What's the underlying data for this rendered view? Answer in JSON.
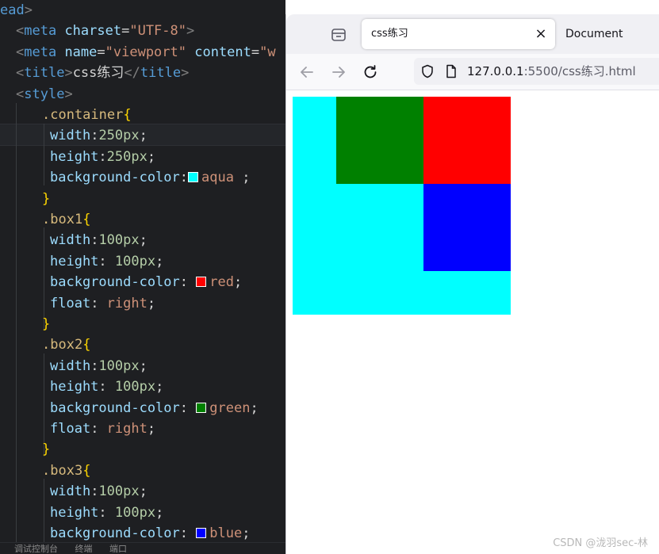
{
  "editor": {
    "bottom_tabs": [
      "调试控制台",
      "终端",
      "端口"
    ],
    "lines": [
      [
        [
          "tag",
          "ead"
        ],
        [
          "punc",
          ">"
        ]
      ],
      [
        [
          "punc",
          "<"
        ],
        [
          "tag",
          "meta "
        ],
        [
          "attr",
          "charset"
        ],
        [
          "txt",
          "="
        ],
        [
          "str",
          "\"UTF-8\""
        ],
        [
          "punc",
          ">"
        ]
      ],
      [
        [
          "punc",
          "<"
        ],
        [
          "tag",
          "meta "
        ],
        [
          "attr",
          "name"
        ],
        [
          "txt",
          "="
        ],
        [
          "str",
          "\"viewport\""
        ],
        [
          "attr",
          " content"
        ],
        [
          "txt",
          "="
        ],
        [
          "str",
          "\"w"
        ]
      ],
      [
        [
          "punc",
          "<"
        ],
        [
          "tag",
          "title"
        ],
        [
          "punc",
          ">"
        ],
        [
          "txt",
          "css练习"
        ],
        [
          "punc",
          "</"
        ],
        [
          "tag",
          "title"
        ],
        [
          "punc",
          ">"
        ]
      ],
      [
        [
          "punc",
          "<"
        ],
        [
          "tag",
          "style"
        ],
        [
          "punc",
          ">"
        ]
      ],
      [
        [
          "sel",
          ".container"
        ],
        [
          "brace",
          "{"
        ]
      ],
      [
        [
          "prop",
          "width"
        ],
        [
          "txt",
          ":"
        ],
        [
          "num",
          "250px"
        ],
        [
          "txt",
          ";"
        ]
      ],
      [
        [
          "prop",
          "height"
        ],
        [
          "txt",
          ":"
        ],
        [
          "num",
          "250px"
        ],
        [
          "txt",
          ";"
        ]
      ],
      [
        [
          "prop",
          "background-color"
        ],
        [
          "txt",
          ":"
        ],
        [
          "swatch",
          "#00ffff"
        ],
        [
          "kw",
          "aqua"
        ],
        [
          "txt",
          " ;"
        ]
      ],
      [
        [
          "brace",
          "}"
        ]
      ],
      [
        [
          "sel",
          ".box1"
        ],
        [
          "brace",
          "{"
        ]
      ],
      [
        [
          "prop",
          "width"
        ],
        [
          "txt",
          ":"
        ],
        [
          "num",
          "100px"
        ],
        [
          "txt",
          ";"
        ]
      ],
      [
        [
          "prop",
          "height"
        ],
        [
          "txt",
          ": "
        ],
        [
          "num",
          "100px"
        ],
        [
          "txt",
          ";"
        ]
      ],
      [
        [
          "prop",
          "background-color"
        ],
        [
          "txt",
          ": "
        ],
        [
          "swatch",
          "#ff0000"
        ],
        [
          "kw",
          "red"
        ],
        [
          "txt",
          ";"
        ]
      ],
      [
        [
          "prop",
          "float"
        ],
        [
          "txt",
          ": "
        ],
        [
          "kw",
          "right"
        ],
        [
          "txt",
          ";"
        ]
      ],
      [
        [
          "brace",
          "}"
        ]
      ],
      [
        [
          "sel",
          ".box2"
        ],
        [
          "brace",
          "{"
        ]
      ],
      [
        [
          "prop",
          "width"
        ],
        [
          "txt",
          ":"
        ],
        [
          "num",
          "100px"
        ],
        [
          "txt",
          ";"
        ]
      ],
      [
        [
          "prop",
          "height"
        ],
        [
          "txt",
          ": "
        ],
        [
          "num",
          "100px"
        ],
        [
          "txt",
          ";"
        ]
      ],
      [
        [
          "prop",
          "background-color"
        ],
        [
          "txt",
          ": "
        ],
        [
          "swatch",
          "#008000"
        ],
        [
          "kw",
          "green"
        ],
        [
          "txt",
          ";"
        ]
      ],
      [
        [
          "prop",
          "float"
        ],
        [
          "txt",
          ": "
        ],
        [
          "kw",
          "right"
        ],
        [
          "txt",
          ";"
        ]
      ],
      [
        [
          "brace",
          "}"
        ]
      ],
      [
        [
          "sel",
          ".box3"
        ],
        [
          "brace",
          "{"
        ]
      ],
      [
        [
          "prop",
          "width"
        ],
        [
          "txt",
          ":"
        ],
        [
          "num",
          "100px"
        ],
        [
          "txt",
          ";"
        ]
      ],
      [
        [
          "prop",
          "height"
        ],
        [
          "txt",
          ": "
        ],
        [
          "num",
          "100px"
        ],
        [
          "txt",
          ";"
        ]
      ],
      [
        [
          "prop",
          "background-color"
        ],
        [
          "txt",
          ": "
        ],
        [
          "swatch",
          "#0000ff"
        ],
        [
          "kw",
          "blue"
        ],
        [
          "txt",
          ";"
        ]
      ]
    ]
  },
  "browser": {
    "active_tab_title": "css练习",
    "close_icon": "×",
    "inactive_tab_title": "Document",
    "url_host": "127.0.0.1",
    "url_rest": ":5500/css练习.html"
  },
  "page_render": {
    "container_color": "#00ffff",
    "box1_color": "#ff0000",
    "box2_color": "#008000",
    "box3_color": "#0000ff"
  },
  "watermark": "CSDN @泷羽sec-林"
}
